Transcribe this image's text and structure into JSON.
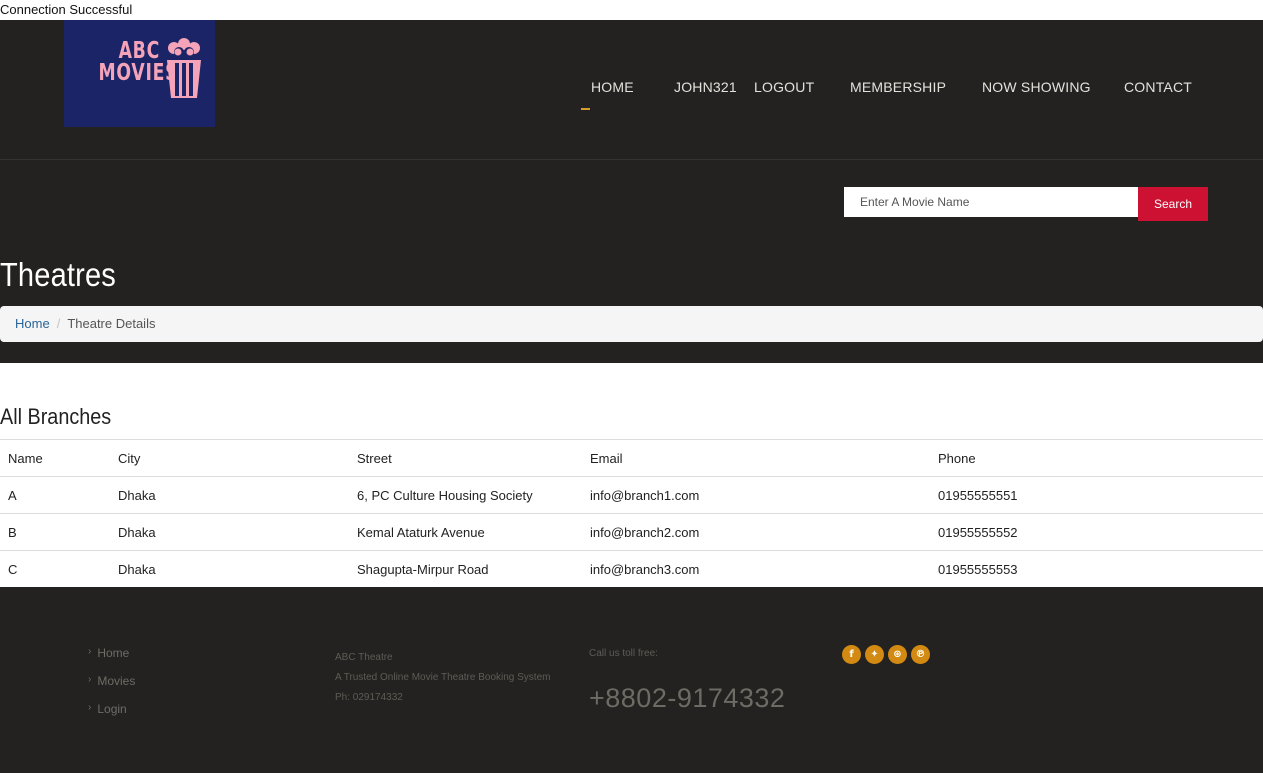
{
  "status_text": "Connection Successful",
  "logo": {
    "line1": "ABC",
    "line2": "MOVIES",
    "icon": "popcorn-icon"
  },
  "nav": {
    "home": "HOME",
    "username": "JOHN321",
    "logout": "LOGOUT",
    "membership": "MEMBERSHIP",
    "now_showing": "NOW SHOWING",
    "contact": "CONTACT"
  },
  "search": {
    "placeholder": "Enter A Movie Name",
    "button_label": "Search"
  },
  "page_title": "Theatres",
  "breadcrumb": {
    "home": "Home",
    "separator": "/",
    "current": "Theatre Details"
  },
  "branches": {
    "title": "All Branches",
    "columns": [
      "Name",
      "City",
      "Street",
      "Email",
      "Phone"
    ],
    "rows": [
      [
        "A",
        "Dhaka",
        "6, PC Culture Housing Society",
        "info@branch1.com",
        "01955555551"
      ],
      [
        "B",
        "Dhaka",
        "Kemal Ataturk Avenue",
        "info@branch2.com",
        "01955555552"
      ],
      [
        "C",
        "Dhaka",
        "Shagupta-Mirpur Road",
        "info@branch3.com",
        "01955555553"
      ]
    ]
  },
  "footer": {
    "links": [
      "Home",
      "Movies",
      "Login"
    ],
    "about": {
      "name": "ABC Theatre",
      "tagline": "A Trusted Online Movie Theatre Booking System",
      "phone": "Ph: 029174332"
    },
    "call_label": "Call us toll free:",
    "call_number": "+8802-9174332",
    "social": [
      "facebook-icon",
      "twitter-icon",
      "dribbble-icon",
      "pinterest-icon"
    ]
  },
  "colors": {
    "header_bg": "#232220",
    "accent": "#d39d2e",
    "search_button": "#cc1132",
    "social": "#d38a12",
    "logo_bg": "#1b2466",
    "logo_text": "#f4a3b9"
  }
}
